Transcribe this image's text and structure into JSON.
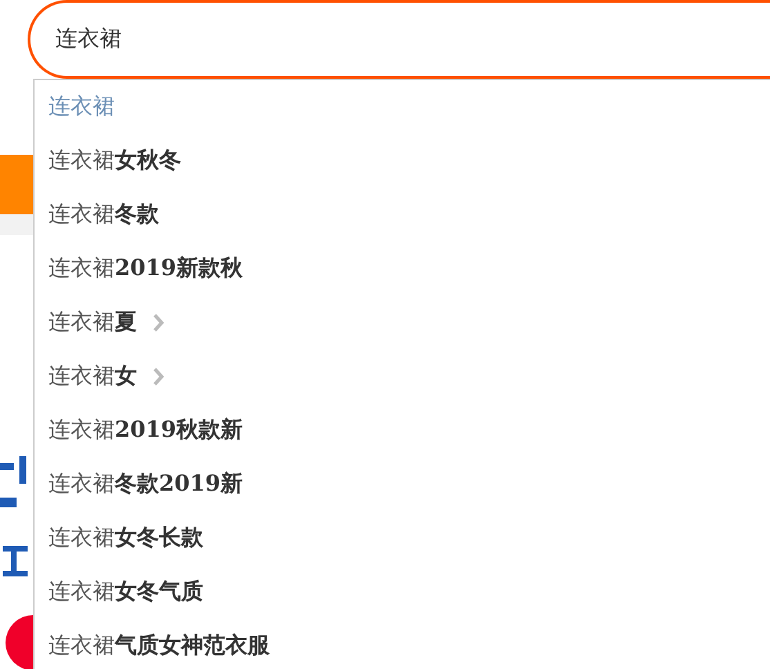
{
  "search": {
    "value": "连衣裙"
  },
  "suggestions": [
    {
      "text": "连衣裙",
      "selected": true,
      "has_more": false
    },
    {
      "text": "连衣裙**女秋冬**",
      "selected": false,
      "has_more": false
    },
    {
      "text": "连衣裙**冬款**",
      "selected": false,
      "has_more": false
    },
    {
      "text": "连衣裙**2019新款秋**",
      "selected": false,
      "has_more": false
    },
    {
      "text": "连衣裙**夏**",
      "selected": false,
      "has_more": true
    },
    {
      "text": "连衣裙**女**",
      "selected": false,
      "has_more": true
    },
    {
      "text": "连衣裙**2019秋款新**",
      "selected": false,
      "has_more": false
    },
    {
      "text": "连衣裙**冬款2019新**",
      "selected": false,
      "has_more": false
    },
    {
      "text": "连衣裙**女冬长款**",
      "selected": false,
      "has_more": false
    },
    {
      "text": "连衣裙**女冬气质**",
      "selected": false,
      "has_more": false
    },
    {
      "text": "连衣裙**气质女神范衣服**",
      "selected": false,
      "has_more": false
    }
  ]
}
